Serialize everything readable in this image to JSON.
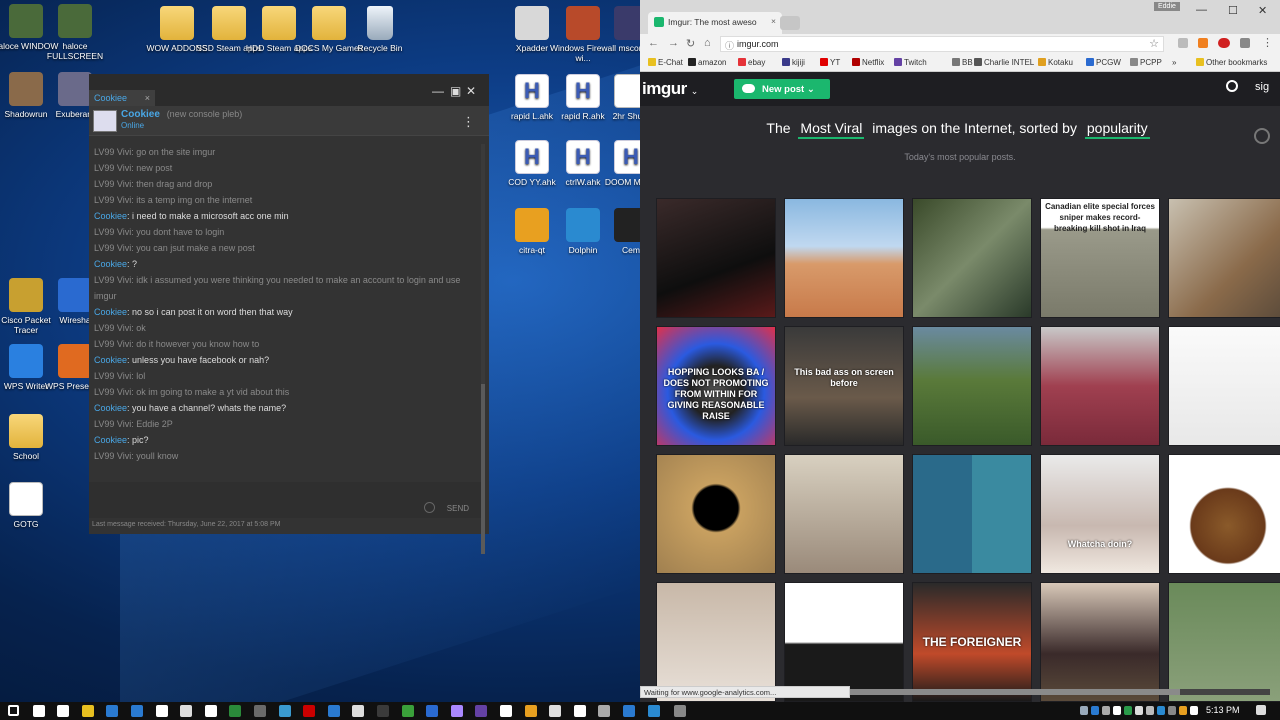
{
  "desktop": {
    "icons": [
      {
        "label": "haloce WINDOW",
        "kind": "app",
        "color": "#4a6a3a"
      },
      {
        "label": "haloce FULLSCREEN",
        "kind": "app",
        "color": "#4a6a3a"
      },
      {
        "label": "WOW ADDONS",
        "kind": "folder"
      },
      {
        "label": "SSD Steam apps",
        "kind": "folder"
      },
      {
        "label": "HDD Steam apps",
        "kind": "folder"
      },
      {
        "label": "DOCS My Games",
        "kind": "folder"
      },
      {
        "label": "Recycle Bin",
        "kind": "bin"
      },
      {
        "label": "Xpadder",
        "kind": "app",
        "color": "#d8d8d8"
      },
      {
        "label": "Windows Firewall wi...",
        "kind": "app",
        "color": "#b84a2a"
      },
      {
        "label": "mscon",
        "kind": "app",
        "color": "#3a3a6a"
      },
      {
        "label": "Shadowrun",
        "kind": "app",
        "color": "#8a6a4a"
      },
      {
        "label": "Exuberant",
        "kind": "app",
        "color": "#6a6a8a"
      },
      {
        "label": "rapid L.ahk",
        "kind": "ahk"
      },
      {
        "label": "rapid R.ahk",
        "kind": "ahk"
      },
      {
        "label": "2hr Shutd",
        "kind": "doc"
      },
      {
        "label": "COD YY.ahk",
        "kind": "ahk"
      },
      {
        "label": "ctrlW.ahk",
        "kind": "ahk"
      },
      {
        "label": "DOOM MP.ah",
        "kind": "ahk"
      },
      {
        "label": "citra-qt",
        "kind": "app",
        "color": "#e8a020"
      },
      {
        "label": "Dolphin",
        "kind": "app",
        "color": "#2a8ad0"
      },
      {
        "label": "Cem",
        "kind": "app",
        "color": "#222"
      },
      {
        "label": "Cisco Packet Tracer",
        "kind": "app",
        "color": "#c8a030"
      },
      {
        "label": "Wiresha",
        "kind": "app",
        "color": "#2a6ad0"
      },
      {
        "label": "WPS Writer",
        "kind": "app",
        "color": "#2a80e0"
      },
      {
        "label": "WPS Presentati",
        "kind": "app",
        "color": "#e06a20"
      },
      {
        "label": "School",
        "kind": "folder"
      },
      {
        "label": "GOTG",
        "kind": "doc"
      }
    ]
  },
  "chat": {
    "tab_label": "Cookiee",
    "tab_close": "×",
    "window_controls": {
      "minimize": "—",
      "maximize": "▣",
      "close": "✕"
    },
    "contact": {
      "name": "Cookiee",
      "subtitle": "(new console pleb)",
      "status": "Online"
    },
    "menu_glyph": "⋮",
    "messages": [
      {
        "who": "LV99 Vivi",
        "side": "v",
        "text": "go on the site imgur"
      },
      {
        "who": "LV99 Vivi",
        "side": "v",
        "text": "new post"
      },
      {
        "who": "LV99 Vivi",
        "side": "v",
        "text": "then drag and drop"
      },
      {
        "who": "LV99 Vivi",
        "side": "v",
        "text": "its a temp img on the internet"
      },
      {
        "who": "Cookiee",
        "side": "c",
        "text": "i need to make a microsoft acc one min"
      },
      {
        "who": "LV99 Vivi",
        "side": "v",
        "text": "you dont have to login"
      },
      {
        "who": "LV99 Vivi",
        "side": "v",
        "text": "you can jsut make a new post"
      },
      {
        "who": "Cookiee",
        "side": "c",
        "text": "?"
      },
      {
        "who": "LV99 Vivi",
        "side": "v",
        "text": "idk i assumed you were thinking you needed to make an account to login and use imgur",
        "wrap": true
      },
      {
        "who": "Cookiee",
        "side": "c",
        "text": "no so i can post it on word then that way"
      },
      {
        "who": "LV99 Vivi",
        "side": "v",
        "text": "ok"
      },
      {
        "who": "LV99 Vivi",
        "side": "v",
        "text": "do it however you know how to"
      },
      {
        "who": "Cookiee",
        "side": "c",
        "text": "unless you have facebook or nah?"
      },
      {
        "who": "LV99 Vivi",
        "side": "v",
        "text": "lol"
      },
      {
        "who": "LV99 Vivi",
        "side": "v",
        "text": "ok im going to make a yt vid about this"
      },
      {
        "who": "Cookiee",
        "side": "c",
        "text": "you have a channel? whats the name?"
      },
      {
        "who": "LV99 Vivi",
        "side": "v",
        "text": "Eddie 2P"
      },
      {
        "who": "Cookiee",
        "side": "c",
        "text": "pic?"
      },
      {
        "who": "LV99 Vivi",
        "side": "v",
        "text": "youll know"
      }
    ],
    "send_label": "SEND",
    "footer": "Last message received: Thursday, June 22, 2017 at 5:08 PM"
  },
  "browser": {
    "tab_title": "Imgur: The most aweso",
    "tab_close": "×",
    "profile": "Eddie",
    "window_controls": {
      "minimize": "—",
      "maximize": "☐",
      "close": "✕"
    },
    "nav": {
      "back": "←",
      "forward": "→",
      "reload": "↻",
      "home": "⌂"
    },
    "url": "imgur.com",
    "bookmarks": [
      {
        "label": "E-Chat",
        "color": "#e8c020"
      },
      {
        "label": "amazon",
        "color": "#222"
      },
      {
        "label": "ebay",
        "color": "#e53238"
      },
      {
        "label": "kijiji",
        "color": "#3a3a8a"
      },
      {
        "label": "YT",
        "color": "#e00000"
      },
      {
        "label": "Netflix",
        "color": "#b00000"
      },
      {
        "label": "Twitch",
        "color": "#6441a4"
      },
      {
        "label": "BB",
        "color": "#777"
      },
      {
        "label": "Charlie INTEL",
        "color": "#555"
      },
      {
        "label": "Kotaku",
        "color": "#e0a020"
      },
      {
        "label": "PCGW",
        "color": "#2a6ad0"
      },
      {
        "label": "PCPP",
        "color": "#888"
      },
      {
        "label": "»",
        "color": ""
      },
      {
        "label": "Other bookmarks",
        "color": "#e8c020"
      }
    ],
    "status": "Waiting for www.google-analytics.com..."
  },
  "imgur": {
    "logo": "imgur",
    "logo_chevron": "⌄",
    "new_post": "New post",
    "new_post_chevron": "⌄",
    "signin": "sig",
    "headline": {
      "pre": "The",
      "h1": "Most Viral",
      "mid": "images on the Internet, sorted by",
      "h2": "popularity"
    },
    "subtitle": "Today's most popular posts.",
    "thumbs": [
      {
        "caption": "",
        "bg": "linear-gradient(160deg,#3a2a2a,#0e0e0e 60%,#5a1a1a)"
      },
      {
        "caption": "",
        "bg": "linear-gradient(#8ab8e0 0%,#c0d8f0 40%,#d89a6a 55%,#c87a4a 100%)"
      },
      {
        "caption": "",
        "bg": "linear-gradient(135deg,#3a4a2a,#7a8a6a 50%,#2a3a2a)"
      },
      {
        "caption": "Canadian elite special forces sniper makes record-breaking kill shot in Iraq",
        "bg": "linear-gradient(#fff 0%,#fff 24%,#9a9a8a 26%,#7a7a6a 100%)"
      },
      {
        "caption": "",
        "bg": "linear-gradient(135deg,#c8c0b0,#8a6a4a 60%,#5a4a3a)"
      },
      {
        "caption": "HOPPING LOOKS BA / DOES NOT PROMOTING FROM WITHIN FOR GIVING REASONABLE RAISE",
        "bg": "radial-gradient(circle at 50% 55%,#555 0%,#222 30%,#2a5ae0 55%,#e0304a 100%)"
      },
      {
        "caption": "This bad ass on screen before",
        "bg": "linear-gradient(#3a3a3a,#6a5a4a 60%,#2a2a2a)"
      },
      {
        "caption": "",
        "bg": "linear-gradient(#6a8aa0,#5a7a3a 45%,#3a5a2a)"
      },
      {
        "caption": "",
        "bg": "linear-gradient(#c8c8c8,#a04050 50%,#7a2a3a)"
      },
      {
        "caption": "",
        "bg": "linear-gradient(#fafafa,#e8e8e8)"
      },
      {
        "caption": "",
        "bg": "radial-gradient(circle at 50% 45%,#000 0%,#000 25%,#c8a060 28%,#a08050 100%)"
      },
      {
        "caption": "",
        "bg": "linear-gradient(#d8d0c0,#9a8a7a)"
      },
      {
        "caption": "",
        "bg": "linear-gradient(90deg,#2a6a8a 50%,#3a8aa0 50%)"
      },
      {
        "caption": "Whatcha doin?",
        "bg": "linear-gradient(#eaeaea,#c8b8b0 60%,#f0e8e0)"
      },
      {
        "caption": "",
        "bg": "radial-gradient(circle at 50% 60%,#8a5a2a 0%,#6a3a1a 40%,#fff 42%)"
      },
      {
        "caption": "",
        "bg": "linear-gradient(#c8b8a8,#e8e0d8)"
      },
      {
        "caption": "",
        "bg": "linear-gradient(#fff 0%,#fff 50%,#1a1a1a 52%)"
      },
      {
        "caption": "THE FOREIGNER",
        "bg": "linear-gradient(#2a2a2a,#c04a2a 60%,#1a1a1a)"
      },
      {
        "caption": "",
        "bg": "linear-gradient(#d8c8b8,#3a2a2a 60%,#5a4a3a)"
      },
      {
        "caption": "",
        "bg": "linear-gradient(#6a8a5a,#8aa07a)"
      }
    ]
  },
  "taskbar": {
    "icons": [
      "#fff",
      "#fff",
      "#fff",
      "#e8c020",
      "#2a7ad0",
      "#2a7ad0",
      "#fff",
      "#ddd",
      "#fff",
      "#2a8a3a",
      "#6a6a6a",
      "#3a9ad0",
      "#c00",
      "#2a7ad0",
      "#ddd",
      "#3a3a3a",
      "#3aa03a",
      "#2a6ad0",
      "#aa88ff",
      "#6441a4",
      "#fff",
      "#e8a020",
      "#ddd",
      "#fff",
      "#aaa",
      "#2a7ad0",
      "#2a7ad0"
    ],
    "active": [
      "#2a8ad0",
      "#888"
    ],
    "time": "5:13 PM"
  }
}
